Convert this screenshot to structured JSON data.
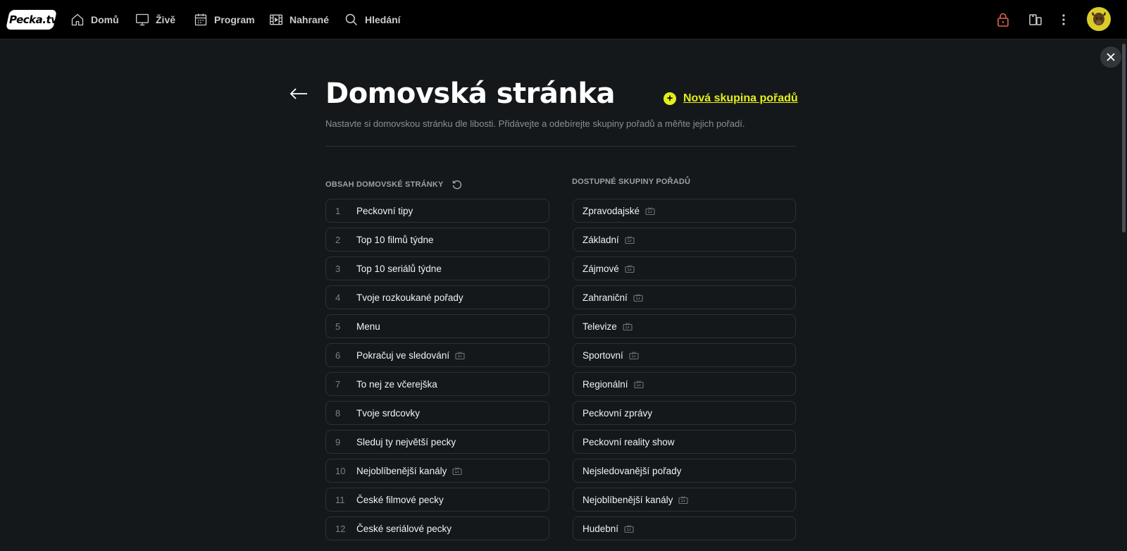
{
  "brand": {
    "logo_text": "Pecka.tv"
  },
  "nav": {
    "items": [
      {
        "id": "home",
        "label": "Domů",
        "icon": "home-icon"
      },
      {
        "id": "live",
        "label": "Živě",
        "icon": "monitor-icon"
      },
      {
        "id": "program",
        "label": "Program",
        "icon": "calendar-icon"
      },
      {
        "id": "recorded",
        "label": "Nahrané",
        "icon": "film-icon"
      },
      {
        "id": "search",
        "label": "Hledání",
        "icon": "search-icon"
      }
    ]
  },
  "colors": {
    "accent": "#e4ef1a",
    "lock": "#e0654c",
    "background": "#15181b",
    "topbar": "#000000"
  },
  "page": {
    "title": "Domovská stránka",
    "subtitle": "Nastavte si domovskou stránku dle libosti. Přidávejte a odebírejte skupiny pořadů a měňte jejich pořadí.",
    "new_group_label": "Nová skupina pořadů"
  },
  "left_section": {
    "heading": "OBSAH DOMOVSKÉ STRÁNKY",
    "items": [
      {
        "num": "1",
        "label": "Peckovní tipy",
        "tv": false
      },
      {
        "num": "2",
        "label": "Top 10 filmů týdne",
        "tv": false
      },
      {
        "num": "3",
        "label": "Top 10 seriálů týdne",
        "tv": false
      },
      {
        "num": "4",
        "label": "Tvoje rozkoukané pořady",
        "tv": false
      },
      {
        "num": "5",
        "label": "Menu",
        "tv": false
      },
      {
        "num": "6",
        "label": "Pokračuj ve sledování",
        "tv": true
      },
      {
        "num": "7",
        "label": "To nej ze včerejška",
        "tv": false
      },
      {
        "num": "8",
        "label": "Tvoje srdcovky",
        "tv": false
      },
      {
        "num": "9",
        "label": "Sleduj ty největší pecky",
        "tv": false
      },
      {
        "num": "10",
        "label": "Nejoblíbenější kanály",
        "tv": true
      },
      {
        "num": "11",
        "label": "České filmové pecky",
        "tv": false
      },
      {
        "num": "12",
        "label": "České seriálové pecky",
        "tv": false
      }
    ]
  },
  "right_section": {
    "heading": "DOSTUPNÉ SKUPINY POŘADŮ",
    "items": [
      {
        "label": "Zpravodajské",
        "tv": true
      },
      {
        "label": "Základní",
        "tv": true
      },
      {
        "label": "Zájmové",
        "tv": true
      },
      {
        "label": "Zahraniční",
        "tv": true
      },
      {
        "label": "Televize",
        "tv": true
      },
      {
        "label": "Sportovní",
        "tv": true
      },
      {
        "label": "Regionální",
        "tv": true
      },
      {
        "label": "Peckovní zprávy",
        "tv": false
      },
      {
        "label": "Peckovní reality show",
        "tv": false
      },
      {
        "label": "Nejsledovanější pořady",
        "tv": false
      },
      {
        "label": "Nejoblíbenější kanály",
        "tv": true
      },
      {
        "label": "Hudební",
        "tv": true
      }
    ]
  }
}
